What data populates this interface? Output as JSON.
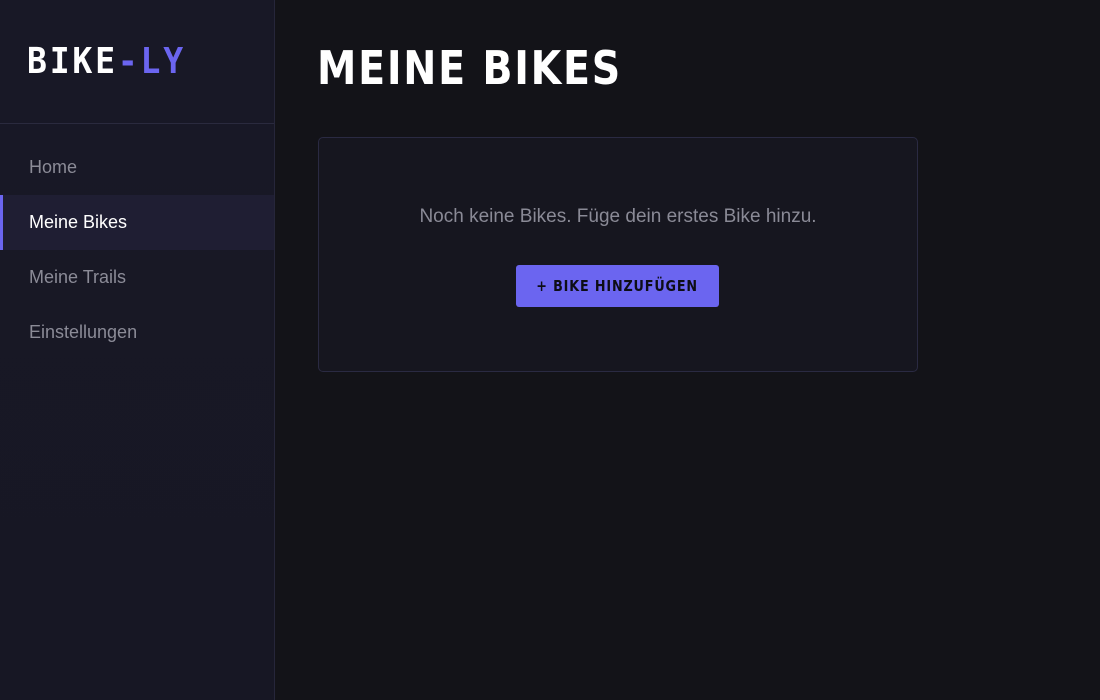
{
  "sidebar": {
    "logo": {
      "part_a": "BIKE",
      "part_b": "-LY"
    },
    "items": [
      {
        "label": "Home",
        "active": false
      },
      {
        "label": "Meine Bikes",
        "active": true
      },
      {
        "label": "Meine Trails",
        "active": false
      },
      {
        "label": "Einstellungen",
        "active": false
      }
    ]
  },
  "main": {
    "title": "MEINE BIKES",
    "empty_state": {
      "message": "Noch keine Bikes. Füge dein erstes Bike hinzu.",
      "button_label": "+ BIKE HINZUFÜGEN"
    }
  },
  "colors": {
    "accent": "#6b65f0",
    "background": "#131318",
    "sidebar": "#181826",
    "text_muted": "#8a8a96"
  }
}
